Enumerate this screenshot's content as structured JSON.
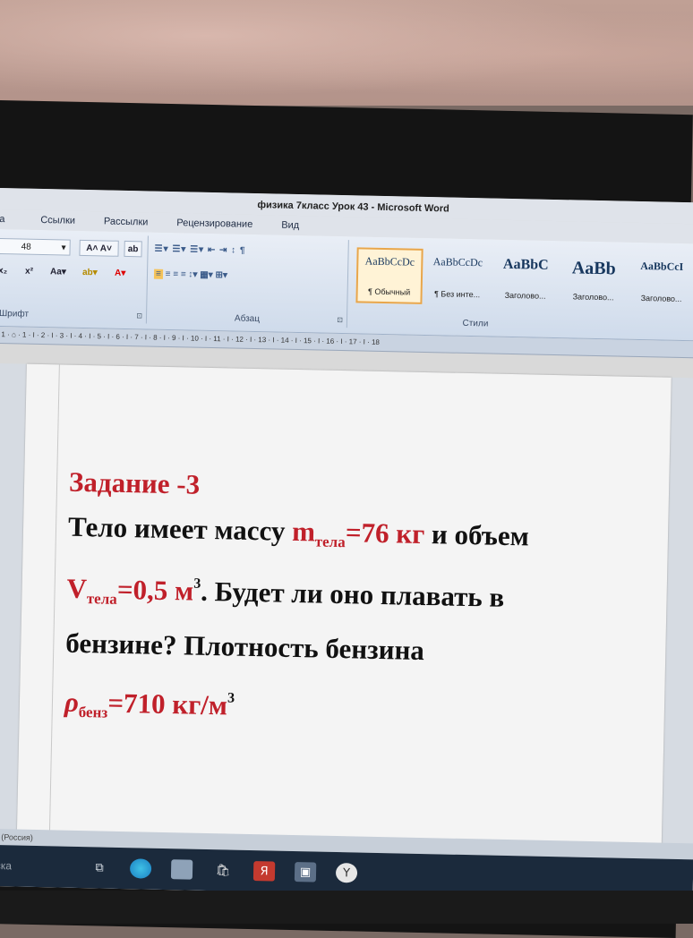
{
  "window": {
    "title": "физика  7класс  Урок 43  -  Microsoft Word"
  },
  "ribbon_tabs": [
    {
      "label": "а"
    },
    {
      "label": "Ссылки"
    },
    {
      "label": "Рассылки"
    },
    {
      "label": "Рецензирование"
    },
    {
      "label": "Вид"
    }
  ],
  "font_group": {
    "size_value": "48",
    "label": "Шрифт"
  },
  "paragraph_group": {
    "label": "Абзац"
  },
  "styles_group": {
    "label": "Стили",
    "styles": [
      {
        "sample": "AaBbCcDc",
        "name": "¶ Обычный"
      },
      {
        "sample": "AaBbCcDc",
        "name": "¶ Без инте..."
      },
      {
        "sample": "AaBbC",
        "name": "Заголово..."
      },
      {
        "sample": "AaBb",
        "name": "Заголово..."
      },
      {
        "sample": "AaBbCcI",
        "name": "Заголово..."
      }
    ]
  },
  "ruler": {
    "marks": "· 1 · ⌂ · 1 · I · 2 · I · 3 · I · 4 · I · 5 · I · 6 · I · 7 · I · 8 · I · 9 · I · 10 · I · 11 · I · 12 · I · 13 · I · 14 · I · 15 · I · 16 · I · 17 · I · 18"
  },
  "document": {
    "heading": "Задание -3",
    "line1_start": "Тело имеет массу ",
    "m_symbol": "m",
    "m_subscript": "тела",
    "m_value": "=76 кг",
    "line1_end": " и объем",
    "v_symbol": "V",
    "v_subscript": "тела",
    "v_value": "=0,5 м",
    "v_exponent": "3",
    "line2_end": ". Будет ли оно плавать в",
    "line3": "бензине? Плотность бензина",
    "rho_symbol": "ρ",
    "rho_subscript": "бенз",
    "rho_value": "=710 кг/м",
    "rho_exponent": "3"
  },
  "status_bar": {
    "language": "ий (Россия)"
  },
  "taskbar": {
    "search_text": "еска",
    "icons": [
      "task-view-icon",
      "edge-icon",
      "mail-icon",
      "store-icon",
      "yandex-icon",
      "photos-icon",
      "browser-icon"
    ]
  },
  "colors": {
    "accent_red": "#c0202a",
    "ribbon": "#dbe5f1",
    "taskbar": "#1b2a3c"
  }
}
